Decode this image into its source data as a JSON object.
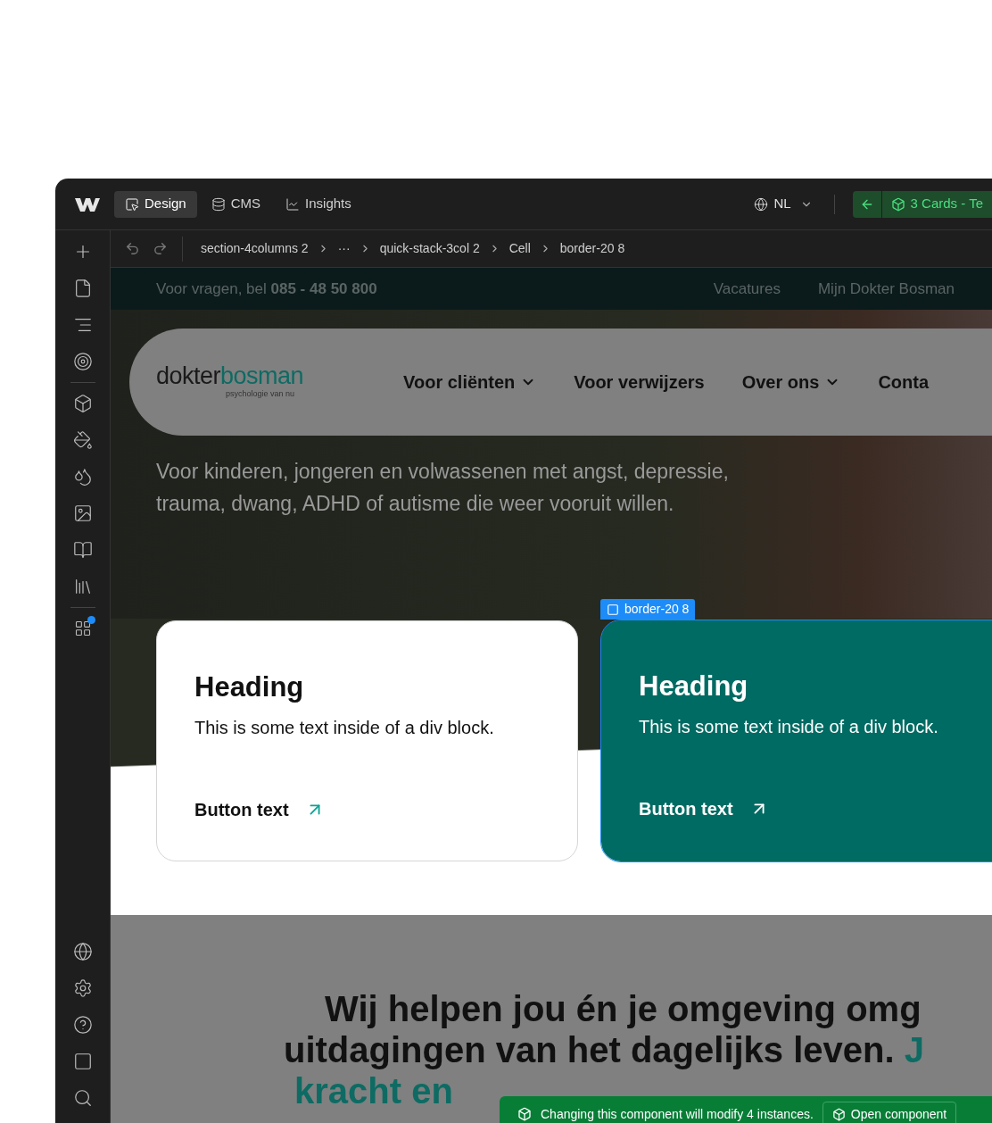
{
  "topbar": {
    "tabs": [
      {
        "label": "Design",
        "selected": true
      },
      {
        "label": "CMS",
        "selected": false
      },
      {
        "label": "Insights",
        "selected": false
      }
    ],
    "locale": "NL",
    "component_pill": "3 Cards - Te"
  },
  "breadcrumbs": [
    "section-4columns 2",
    "···",
    "quick-stack-3col 2",
    "Cell",
    "border-20 8"
  ],
  "site": {
    "top_strip": {
      "text": "Voor vragen, bel **085 - 48 50 800**",
      "links": [
        "Vacatures",
        "Mijn Dokter Bosman"
      ]
    },
    "logo": {
      "word_1": "dokter",
      "word_2": "bosman",
      "tagline": "psychologie van nu"
    },
    "nav": [
      {
        "label": "Voor cliënten",
        "dropdown": true
      },
      {
        "label": "Voor verwijzers",
        "dropdown": false
      },
      {
        "label": "Over ons",
        "dropdown": true
      },
      {
        "label": "Conta",
        "dropdown": false
      }
    ],
    "hero_text": "Voor kinderen, jongeren en volwassenen met angst, depressie, trauma, dwang, ADHD of autisme die weer vooruit willen.",
    "cards": [
      {
        "heading": "Heading",
        "text": "This is some text inside of a div block.",
        "button": "Button text",
        "selected": false
      },
      {
        "heading": "Heading",
        "text": "This is some text inside of a div block.",
        "button": "Button text",
        "selected": true
      }
    ],
    "selection_label": "border-20 8",
    "section_heading": [
      {
        "text": "Wij helpen jou én je omgeving omg"
      },
      {
        "text": "uitdagingen van het dagelijks leven. ",
        "accent": "J"
      },
      {
        "accent": "kracht en"
      }
    ]
  },
  "toast": {
    "message": "Changing this component will modify 4 instances.",
    "button": "Open component"
  }
}
